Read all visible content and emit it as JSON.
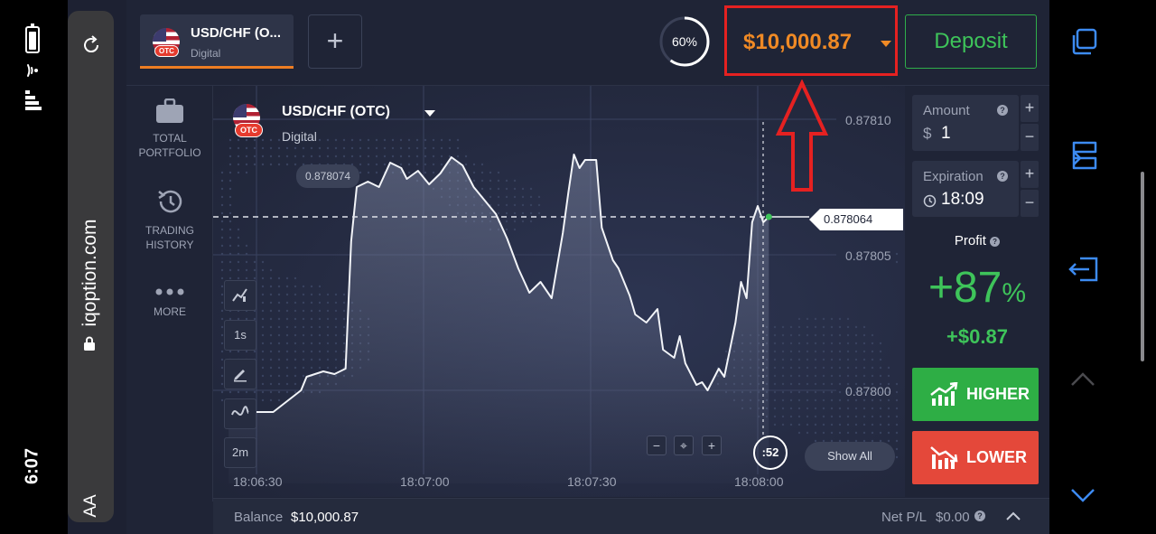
{
  "status_bar": {
    "time": "6:07"
  },
  "browser": {
    "url": "iqoption.com",
    "text_size_label": "AA"
  },
  "topbar": {
    "asset_tab": {
      "name": "USD/CHF (O...",
      "type": "Digital",
      "badge": "OTC"
    },
    "add_tab_label": "+",
    "timer_percent": "60%",
    "balance": "$10,000.87",
    "deposit_label": "Deposit"
  },
  "left_nav": [
    {
      "label": "TOTAL PORTFOLIO",
      "icon": "briefcase-icon"
    },
    {
      "label": "TRADING HISTORY",
      "icon": "history-icon"
    },
    {
      "label": "MORE",
      "icon": "more-dots-icon"
    }
  ],
  "chart": {
    "asset_name": "USD/CHF (OTC)",
    "asset_type": "Digital",
    "badge": "OTC",
    "hover_value": "0.878074",
    "current_price": "0.878064",
    "countdown": ":52",
    "show_all_label": "Show All",
    "tools": [
      "chart-type-icon",
      "1s",
      "pencil-icon",
      "indicator-icon",
      "2m"
    ],
    "zoom": {
      "minus": "−",
      "center": "⌖",
      "plus": "+"
    }
  },
  "chart_data": {
    "type": "line",
    "x_ticks": [
      "18:06:30",
      "18:07:00",
      "18:07:30",
      "18:08:00"
    ],
    "y_ticks": [
      "0.87810",
      "0.87805",
      "0.87800"
    ],
    "ylim": [
      0.87797,
      0.87812
    ],
    "x_range_seconds": [
      -12,
      92
    ],
    "series": [
      {
        "values": [
          [
            -5,
            0.87799
          ],
          [
            0,
            0.877992
          ],
          [
            3,
            0.877992
          ],
          [
            8,
            0.878
          ],
          [
            9,
            0.878005
          ],
          [
            12,
            0.878007
          ],
          [
            14,
            0.878006
          ],
          [
            16,
            0.878008
          ],
          [
            17,
            0.878055
          ],
          [
            18,
            0.878075
          ],
          [
            20,
            0.878077
          ],
          [
            22,
            0.878075
          ],
          [
            24,
            0.878084
          ],
          [
            26,
            0.878082
          ],
          [
            27,
            0.878078
          ],
          [
            29,
            0.878081
          ],
          [
            31,
            0.878076
          ],
          [
            33,
            0.87808
          ],
          [
            35,
            0.878086
          ],
          [
            37,
            0.878083
          ],
          [
            39,
            0.878075
          ],
          [
            41,
            0.87807
          ],
          [
            43,
            0.878065
          ],
          [
            45,
            0.878056
          ],
          [
            47,
            0.878045
          ],
          [
            49,
            0.878036
          ],
          [
            51,
            0.87804
          ],
          [
            53,
            0.878034
          ],
          [
            55,
            0.878058
          ],
          [
            56,
            0.878073
          ],
          [
            57,
            0.878087
          ],
          [
            58,
            0.878082
          ],
          [
            59,
            0.878085
          ],
          [
            61,
            0.878085
          ],
          [
            62,
            0.87806
          ],
          [
            64,
            0.878048
          ],
          [
            65,
            0.878045
          ],
          [
            67,
            0.878035
          ],
          [
            68,
            0.878028
          ],
          [
            70,
            0.878025
          ],
          [
            72,
            0.87803
          ],
          [
            73,
            0.878015
          ],
          [
            75,
            0.878012
          ],
          [
            76,
            0.87802
          ],
          [
            77,
            0.87801
          ],
          [
            79,
            0.878002
          ],
          [
            80,
            0.878003
          ],
          [
            81,
            0.878
          ],
          [
            83,
            0.878008
          ],
          [
            84,
            0.878005
          ],
          [
            86,
            0.878025
          ],
          [
            87,
            0.87804
          ],
          [
            88,
            0.878034
          ],
          [
            89,
            0.878062
          ],
          [
            90,
            0.878068
          ],
          [
            91,
            0.878062
          ],
          [
            92,
            0.878064
          ]
        ]
      }
    ]
  },
  "trade_panel": {
    "amount_label": "Amount",
    "amount_prefix": "$",
    "amount_value": "1",
    "expiration_label": "Expiration",
    "expiration_value": "18:09",
    "profit_label": "Profit",
    "profit_percent": "+87",
    "profit_percent_sign": "%",
    "profit_amount": "+$0.87",
    "higher_label": "HIGHER",
    "lower_label": "LOWER",
    "colors": {
      "higher": "#2eae45",
      "lower": "#e4483a",
      "accent": "#ee7d23"
    }
  },
  "bottom_bar": {
    "balance_label": "Balance",
    "balance_value": "$10,000.87",
    "net_pl_label": "Net P/L",
    "net_pl_value": "$0.00"
  }
}
